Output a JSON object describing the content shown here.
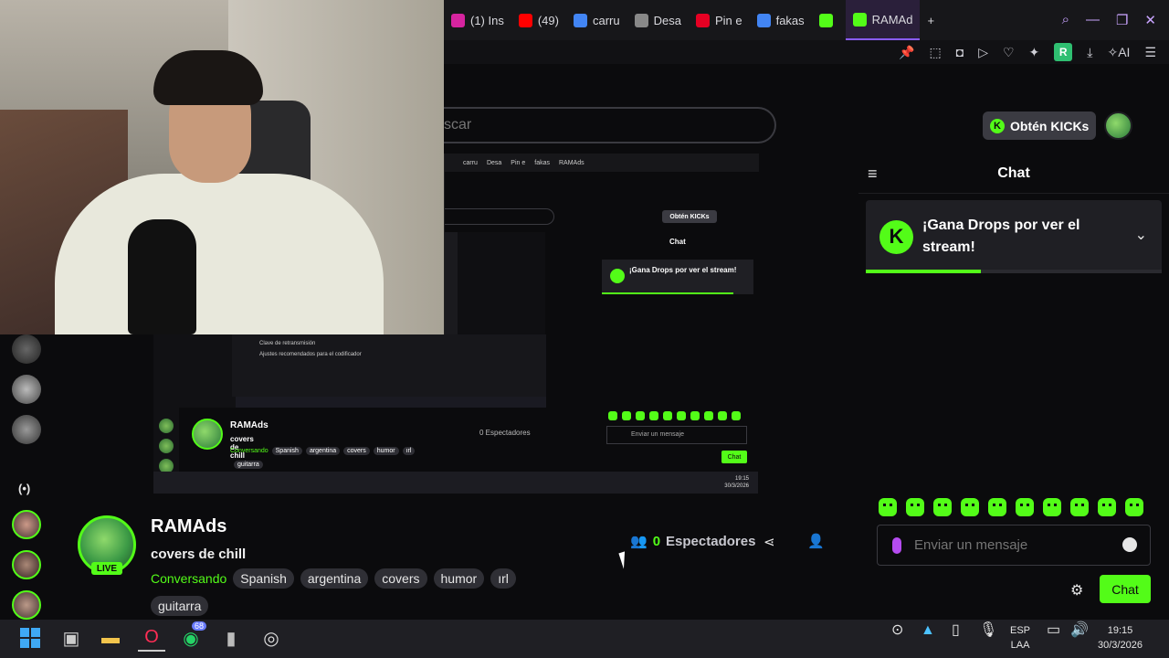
{
  "browser": {
    "tabs": [
      {
        "label": "(1) Ins",
        "color": "#d6249f"
      },
      {
        "label": "(49) ",
        "color": "#ff0000"
      },
      {
        "label": "carru",
        "color": "#4285f4"
      },
      {
        "label": "Desa",
        "color": "#888888"
      },
      {
        "label": "Pin e",
        "color": "#e60023"
      },
      {
        "label": "fakas",
        "color": "#4285f4"
      },
      {
        "label": "",
        "color": "#53fc18"
      },
      {
        "label": "RAMAd",
        "color": "#53fc18"
      }
    ],
    "new_tab": "+",
    "toolbar_r": "R",
    "toolbar_ai": "AI"
  },
  "kick": {
    "search_placeholder": "scar",
    "get_kicks": "Obtén KICKs",
    "k_letter": "K"
  },
  "chat": {
    "title": "Chat",
    "drops_text": "¡Gana Drops por ver el stream!",
    "drops_progress": 0.39,
    "input_placeholder": "Enviar un mensaje",
    "send_label": "Chat",
    "emote_count": 10
  },
  "channel": {
    "name": "RAMAds",
    "title": "covers de chill",
    "live": "LIVE",
    "category": "Conversando",
    "tags": [
      "Spanish",
      "argentina",
      "covers",
      "humor",
      "ırl"
    ],
    "tags_row2": [
      "guitarra"
    ],
    "viewers_count": "0",
    "viewers_label": "Espectadores"
  },
  "preview": {
    "tabs": [
      "carru",
      "Desa",
      "Pin e",
      "fakas",
      "RAMAds"
    ],
    "get_kicks": "Obtén KICKs",
    "chat_title": "Chat",
    "drops_text": "¡Gana Drops por ver el stream!",
    "name": "RAMAds",
    "title": "covers de chill",
    "category": "Conversando",
    "tags": [
      "Spanish",
      "argentina",
      "covers",
      "humor",
      "ırl"
    ],
    "tag2": "guitarra",
    "viewers": "0 Espectadores",
    "chat_input": "Enviar un mensaje",
    "chat_btn": "Chat",
    "panel_line1": "Clave de retransmisión",
    "panel_line2": "Ajustes recomendados para el codificador",
    "clock_time": "19:15",
    "clock_date": "30/3/2026"
  },
  "taskbar": {
    "whatsapp_badge": "68",
    "lang": "ESP",
    "lang2": "LAA",
    "time": "19:15",
    "date": "30/3/2026"
  },
  "colors": {
    "accent": "#53fc18",
    "bg": "#0b0b0d"
  }
}
